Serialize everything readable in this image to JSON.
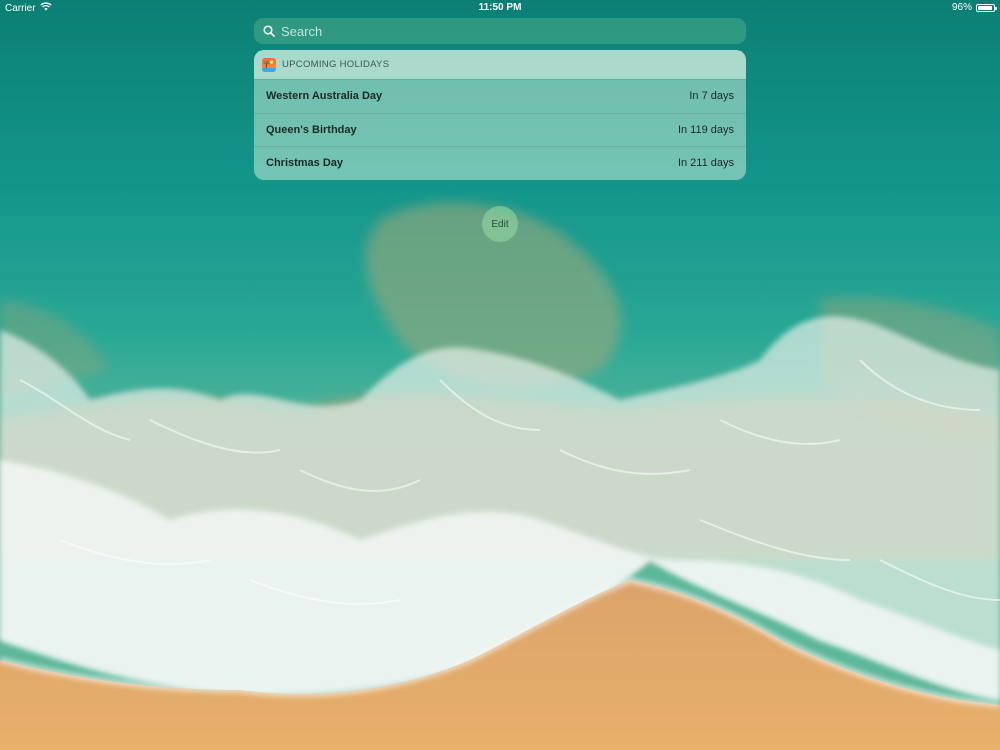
{
  "status_bar": {
    "carrier": "Carrier",
    "time": "11:50 PM",
    "battery_percent_label": "96%",
    "battery_level": 0.96,
    "wifi_icon": "wifi-icon",
    "battery_icon": "battery-icon"
  },
  "search": {
    "placeholder": "Search",
    "icon": "search-icon"
  },
  "widget": {
    "title": "UPCOMING HOLIDAYS",
    "app_icon": "holidays-app-icon",
    "holidays": [
      {
        "name": "Western Australia Day",
        "countdown": "In 7 days"
      },
      {
        "name": "Queen's Birthday",
        "countdown": "In 119 days"
      },
      {
        "name": "Christmas Day",
        "countdown": "In 211 days"
      }
    ]
  },
  "edit_button": {
    "label": "Edit"
  },
  "colors": {
    "ocean_deep": "#0c7f74",
    "ocean_teal": "#1aa593",
    "sand": "#e3a968",
    "foam": "#f3f7f5"
  }
}
